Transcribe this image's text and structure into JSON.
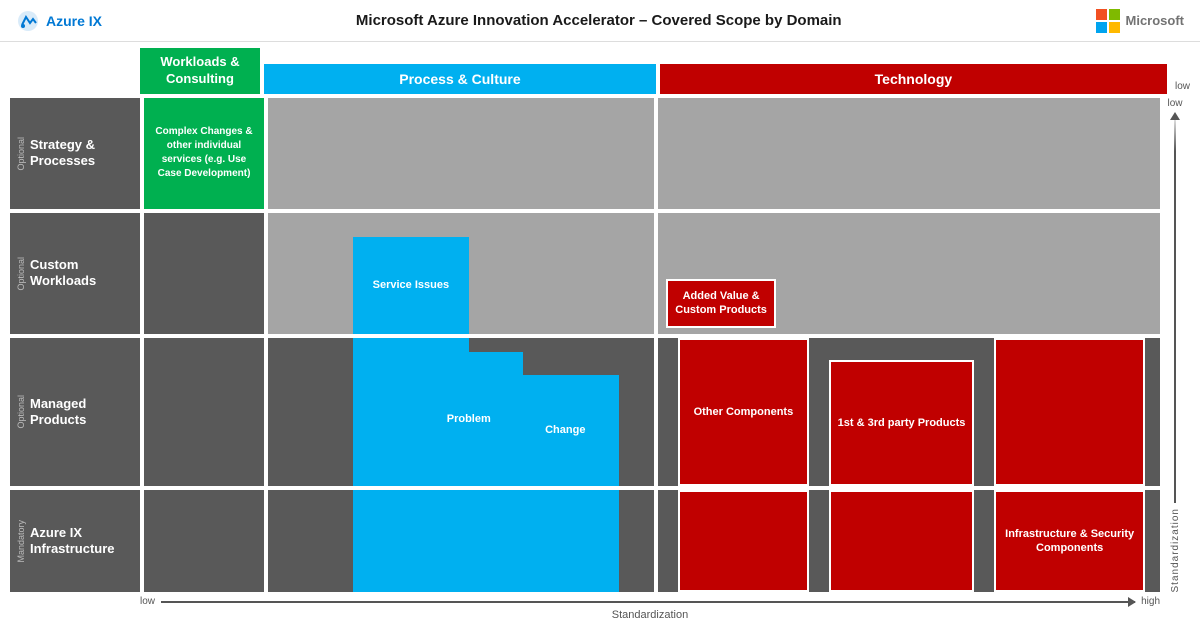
{
  "header": {
    "logo_text": "Azure IX",
    "title": "Microsoft Azure Innovation Accelerator – Covered Scope by Domain",
    "ms_label": "Microsoft"
  },
  "columns": {
    "workloads_label": "Workloads & Consulting",
    "process_label": "Process & Culture",
    "technology_label": "Technology"
  },
  "rows": {
    "strategy": {
      "tag": "Optional",
      "name": "Strategy & Processes"
    },
    "custom": {
      "tag": "Optional",
      "name": "Custom Workloads"
    },
    "managed": {
      "tag": "Optional",
      "name": "Managed Products"
    },
    "infra": {
      "tag": "Mandatory",
      "name": "Azure IX Infrastructure"
    }
  },
  "cells": {
    "workloads_green": "Complex Changes & other individual services (e.g. Use Case Development)",
    "process_service_issues": "Service Issues",
    "process_problem": "Problem",
    "process_change": "Change",
    "tech_added_value": "Added Value & Custom Products",
    "tech_other": "Other Components",
    "tech_1st_3rd": "1st & 3rd party Products",
    "tech_infra_security": "Infrastructure & Security Components"
  },
  "axis": {
    "low": "low",
    "high": "high",
    "standardization": "Standardization",
    "side_low": "low"
  }
}
